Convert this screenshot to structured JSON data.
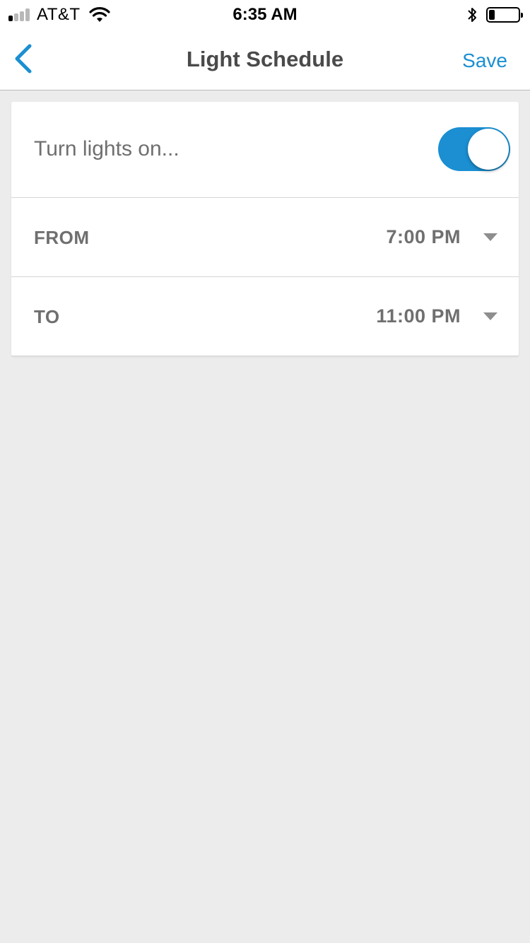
{
  "status_bar": {
    "carrier": "AT&T",
    "time": "6:35 AM",
    "signal_bars_active": 1,
    "signal_bars_total": 4,
    "battery_level": 0.2,
    "icons": [
      "wifi-icon",
      "bluetooth-icon",
      "battery-icon"
    ]
  },
  "nav": {
    "title": "Light Schedule",
    "save_label": "Save",
    "back_icon": "chevron-left-icon"
  },
  "schedule": {
    "toggle_label": "Turn lights on...",
    "toggle_on": true,
    "from": {
      "label": "FROM",
      "value": "7:00 PM"
    },
    "to": {
      "label": "TO",
      "value": "11:00 PM"
    }
  },
  "colors": {
    "accent": "#1b8fd2",
    "background": "#ececec",
    "card": "#ffffff",
    "text_muted": "#6f6f6f"
  }
}
